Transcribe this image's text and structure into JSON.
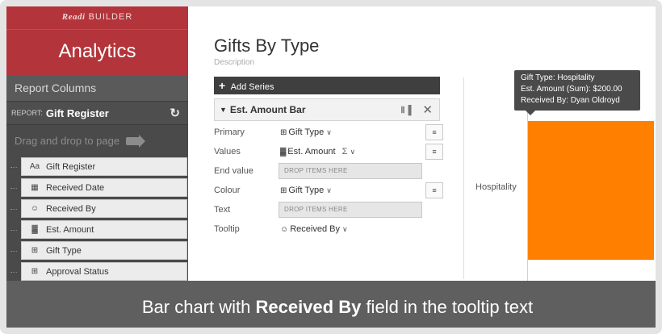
{
  "sidebar": {
    "brand_name": "Readi",
    "brand_suffix": "BUILDER",
    "app_title": "Analytics",
    "section_title": "Report Columns",
    "report_prefix": "REPORT:",
    "report_name": "Gift Register",
    "drag_hint": "Drag and drop to page",
    "fields": [
      {
        "label": "Gift Register",
        "icon": "Aa"
      },
      {
        "label": "Received Date",
        "icon": "calendar-icon"
      },
      {
        "label": "Received By",
        "icon": "person-icon"
      },
      {
        "label": "Est. Amount",
        "icon": "measure-icon"
      },
      {
        "label": "Gift Type",
        "icon": "table-icon"
      },
      {
        "label": "Approval Status",
        "icon": "table-icon"
      }
    ]
  },
  "main": {
    "title": "Gifts By Type",
    "description": "Description",
    "add_series": "Add Series",
    "series_name": "Est. Amount Bar",
    "props": {
      "primary_label": "Primary",
      "primary_value": "Gift Type",
      "values_label": "Values",
      "values_value": "Est. Amount",
      "values_agg": "Σ",
      "end_label": "End value",
      "end_placeholder": "DROP ITEMS HERE",
      "colour_label": "Colour",
      "colour_value": "Gift Type",
      "text_label": "Text",
      "text_placeholder": "DROP ITEMS HERE",
      "tooltip_label": "Tooltip",
      "tooltip_value": "Received By"
    }
  },
  "chart": {
    "category_label": "Hospitality",
    "bar_color": "#ff8000",
    "tooltip": {
      "line1": "Gift Type: Hospitality",
      "line2": "Est. Amount (Sum): $200.00",
      "line3": "Received By: Dyan Oldroyd"
    }
  },
  "caption": {
    "before": "Bar chart with ",
    "bold": "Received By",
    "after": " field in the tooltip text"
  }
}
